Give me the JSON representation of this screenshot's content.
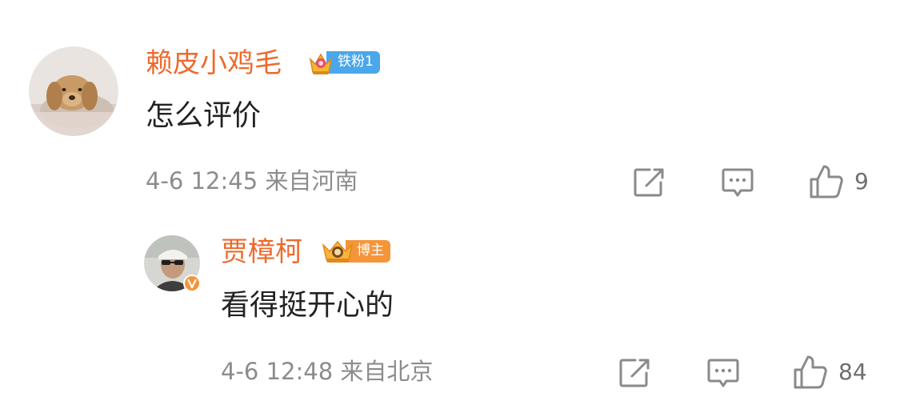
{
  "comments": [
    {
      "username": "赖皮小鸡毛",
      "badge": "铁粉1",
      "text": "怎么评价",
      "meta": "4-6 12:45 来自河南",
      "likes": "9"
    },
    {
      "username": "贾樟柯",
      "badge": "博主",
      "text": "看得挺开心的",
      "meta": "4-6 12:48 来自北京",
      "likes": "84"
    }
  ],
  "colors": {
    "username": "#ee6a2c",
    "fan_badge": "#4aa7ea",
    "host_badge": "#f4953a",
    "meta": "#8c8c8c",
    "icon": "#8a8a8a"
  },
  "icons": [
    "share-icon",
    "reply-icon",
    "like-icon",
    "crown-icon",
    "verified-icon"
  ]
}
